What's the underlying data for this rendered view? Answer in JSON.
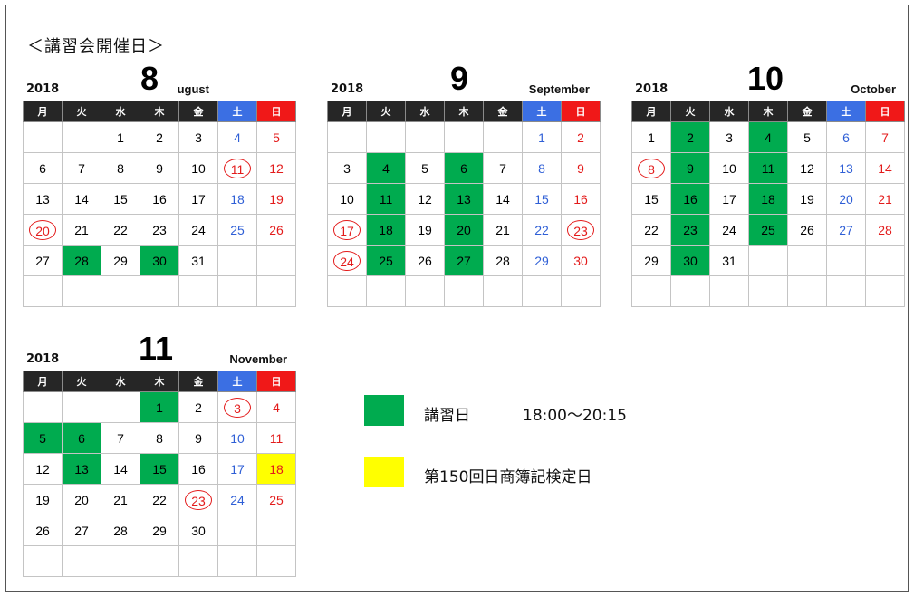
{
  "title": "＜講習会開催日＞",
  "weekdays": [
    "月",
    "火",
    "水",
    "木",
    "金",
    "土",
    "日"
  ],
  "colors": {
    "lecture_day": "#00ab4f",
    "exam_day": "#ffff00",
    "saturday": "#3b6fe3",
    "sunday": "#f01818",
    "header": "#262626"
  },
  "months": [
    {
      "year": "2018",
      "num": "8",
      "name": "ugust",
      "rows": [
        [
          "",
          "",
          "1",
          "2",
          "3",
          "4",
          "5"
        ],
        [
          "6",
          "7",
          "8",
          "9",
          "10",
          "11",
          "12"
        ],
        [
          "13",
          "14",
          "15",
          "16",
          "17",
          "18",
          "19"
        ],
        [
          "20",
          "21",
          "22",
          "23",
          "24",
          "25",
          "26"
        ],
        [
          "27",
          "28",
          "29",
          "30",
          "31",
          "",
          ""
        ],
        [
          "",
          "",
          "",
          "",
          "",
          "",
          ""
        ]
      ]
    },
    {
      "year": "2018",
      "num": "9",
      "name": "September",
      "rows": [
        [
          "",
          "",
          "",
          "",
          "",
          "1",
          "2"
        ],
        [
          "3",
          "4",
          "5",
          "6",
          "7",
          "8",
          "9"
        ],
        [
          "10",
          "11",
          "12",
          "13",
          "14",
          "15",
          "16"
        ],
        [
          "17",
          "18",
          "19",
          "20",
          "21",
          "22",
          "23"
        ],
        [
          "24",
          "25",
          "26",
          "27",
          "28",
          "29",
          "30"
        ],
        [
          "",
          "",
          "",
          "",
          "",
          "",
          ""
        ]
      ]
    },
    {
      "year": "2018",
      "num": "10",
      "name": "October",
      "rows": [
        [
          "1",
          "2",
          "3",
          "4",
          "5",
          "6",
          "7"
        ],
        [
          "8",
          "9",
          "10",
          "11",
          "12",
          "13",
          "14"
        ],
        [
          "15",
          "16",
          "17",
          "18",
          "19",
          "20",
          "21"
        ],
        [
          "22",
          "23",
          "24",
          "25",
          "26",
          "27",
          "28"
        ],
        [
          "29",
          "30",
          "31",
          "",
          "",
          "",
          ""
        ],
        [
          "",
          "",
          "",
          "",
          "",
          "",
          ""
        ]
      ]
    },
    {
      "year": "2018",
      "num": "11",
      "name": "November",
      "rows": [
        [
          "",
          "",
          "",
          "1",
          "2",
          "3",
          "4"
        ],
        [
          "5",
          "6",
          "7",
          "8",
          "9",
          "10",
          "11"
        ],
        [
          "12",
          "13",
          "14",
          "15",
          "16",
          "17",
          "18"
        ],
        [
          "19",
          "20",
          "21",
          "22",
          "23",
          "24",
          "25"
        ],
        [
          "26",
          "27",
          "28",
          "29",
          "30",
          "",
          ""
        ],
        [
          "",
          "",
          "",
          "",
          "",
          "",
          ""
        ]
      ]
    }
  ],
  "legend": {
    "lecture_label": "講習日",
    "lecture_time": "18:00〜20:15",
    "exam_label": "第150回日商簿記検定日"
  }
}
